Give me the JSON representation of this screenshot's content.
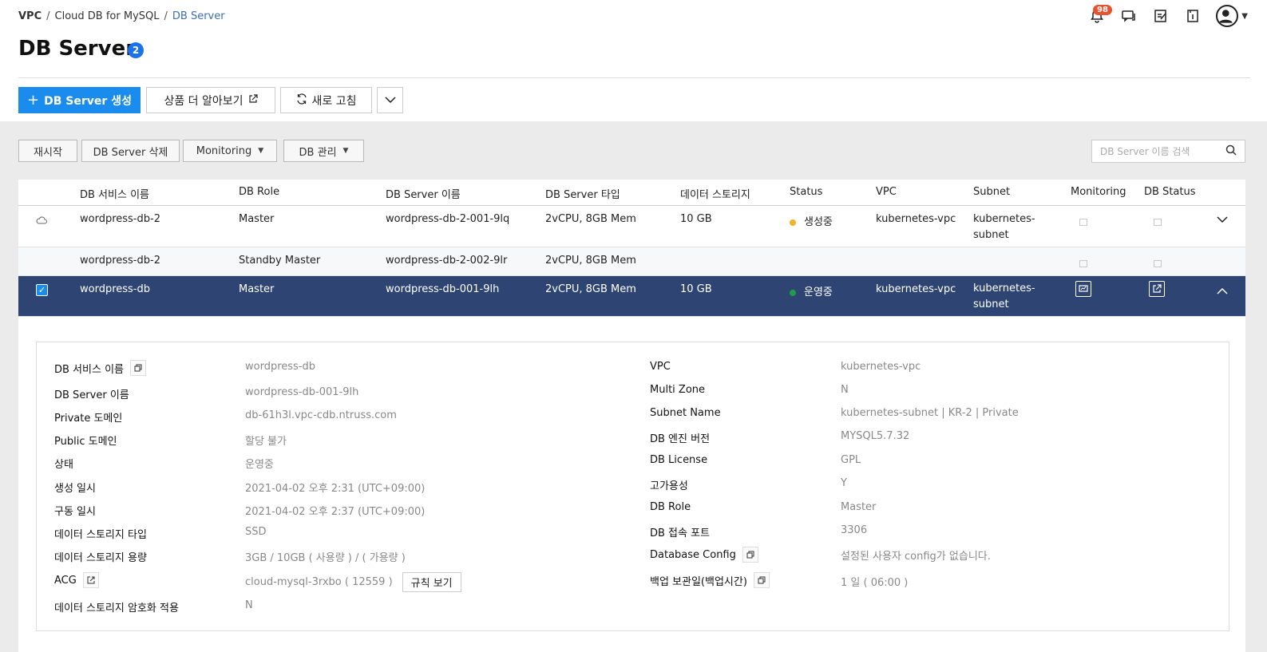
{
  "breadcrumb": [
    "VPC",
    "Cloud DB for MySQL",
    "DB Server"
  ],
  "page": {
    "title": "DB Server",
    "count": "2"
  },
  "header": {
    "notification_count": "98"
  },
  "toolbar": {
    "create_label": "DB Server 생성",
    "learn_more_label": "상품 더 알아보기",
    "refresh_label": "새로 고침"
  },
  "actions": {
    "restart": "재시작",
    "delete": "DB Server 삭제",
    "monitoring": "Monitoring",
    "db_manage": "DB 관리"
  },
  "search": {
    "placeholder": "DB Server 이름 검색"
  },
  "table": {
    "columns": [
      "DB 서비스 이름",
      "DB Role",
      "DB Server 이름",
      "DB Server 타입",
      "데이터 스토리지",
      "Status",
      "VPC",
      "Subnet",
      "Monitoring",
      "DB Status"
    ],
    "rows": [
      {
        "service": "wordpress-db-2",
        "role": "Master",
        "server": "wordpress-db-2-001-9lq",
        "type": "2vCPU, 8GB Mem",
        "storage": "10 GB",
        "status": "생성중",
        "vpc": "kubernetes-vpc",
        "subnet_1": "kubernetes-",
        "subnet_2": "subnet"
      },
      {
        "service": "wordpress-db-2",
        "role": "Standby Master",
        "server": "wordpress-db-2-002-9lr",
        "type": "2vCPU, 8GB Mem"
      },
      {
        "service": "wordpress-db",
        "role": "Master",
        "server": "wordpress-db-001-9lh",
        "type": "2vCPU, 8GB Mem",
        "storage": "10 GB",
        "status": "운영중",
        "vpc": "kubernetes-vpc",
        "subnet_1": "kubernetes-",
        "subnet_2": "subnet"
      }
    ]
  },
  "detail": {
    "left": [
      {
        "label": "DB 서비스 이름",
        "value": "wordpress-db"
      },
      {
        "label": "DB Server 이름",
        "value": "wordpress-db-001-9lh"
      },
      {
        "label": "Private 도메인",
        "value": "db-61h3l.vpc-cdb.ntruss.com"
      },
      {
        "label": "Public 도메인",
        "value": "할당 불가"
      },
      {
        "label": "상태",
        "value": "운영중"
      },
      {
        "label": "생성 일시",
        "value": "2021-04-02 오후 2:31 (UTC+09:00)"
      },
      {
        "label": "구동 일시",
        "value": "2021-04-02 오후 2:37 (UTC+09:00)"
      },
      {
        "label": "데이터 스토리지 타입",
        "value": "SSD"
      },
      {
        "label": "데이터 스토리지 용량",
        "value": "3GB / 10GB ( 사용량 ) / ( 가용량 )"
      },
      {
        "label": "ACG",
        "value": "cloud-mysql-3rxbo ( 12559 )"
      },
      {
        "label": "데이터 스토리지 암호화 적용",
        "value": "N"
      }
    ],
    "acg_rule_button": "규칙 보기",
    "right": [
      {
        "label": "VPC",
        "value": "kubernetes-vpc"
      },
      {
        "label": "Multi Zone",
        "value": "N"
      },
      {
        "label": "Subnet Name",
        "value": "kubernetes-subnet | KR-2 | Private"
      },
      {
        "label": "DB 엔진 버전",
        "value": "MYSQL5.7.32"
      },
      {
        "label": "DB License",
        "value": "GPL"
      },
      {
        "label": "고가용성",
        "value": "Y"
      },
      {
        "label": "DB Role",
        "value": "Master"
      },
      {
        "label": "DB 접속 포트",
        "value": "3306"
      },
      {
        "label": "Database Config",
        "value": "설정된 사용자 config가 없습니다."
      },
      {
        "label": "백업 보관일(백업시간)",
        "value": "1 일 ( 06:00 )"
      }
    ]
  },
  "colors": {
    "primary": "#1a8ced",
    "selected_row": "#2e4472",
    "creating": "#f0b429",
    "running": "#1e9e4a",
    "badge": "#e8532f"
  },
  "icons": [
    "bell-icon",
    "chat-icon",
    "note-icon",
    "book-icon",
    "user-avatar-icon",
    "external-link-icon",
    "refresh-icon",
    "plus-icon",
    "search-icon",
    "cloud-icon",
    "copy-icon",
    "chevron-down-icon",
    "chevron-up-icon"
  ]
}
